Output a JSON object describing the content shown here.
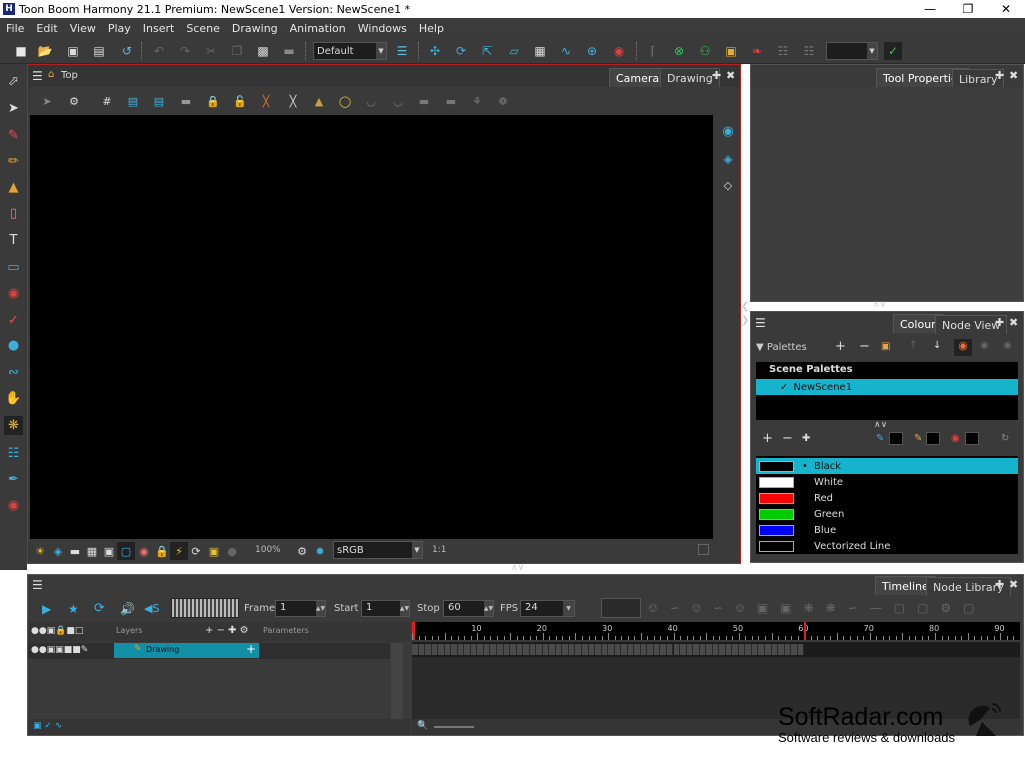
{
  "window": {
    "title": "Toon Boom Harmony 21.1 Premium: NewScene1 Version: NewScene1 *",
    "app_icon": "H"
  },
  "menu": [
    "File",
    "Edit",
    "View",
    "Play",
    "Insert",
    "Scene",
    "Drawing",
    "Animation",
    "Windows",
    "Help"
  ],
  "toolbar": {
    "workspace": "Default"
  },
  "camera_view": {
    "breadcrumb": "Top",
    "tabs": [
      "Camera",
      "Drawing"
    ],
    "zoom": "100%",
    "color_space": "sRGB",
    "ratio": "1:1"
  },
  "tool_properties": {
    "tabs": [
      "Tool Properties",
      "Library"
    ]
  },
  "colour": {
    "tabs": [
      "Colour",
      "Node View"
    ],
    "palettes_label": "Palettes",
    "scene_palettes_header": "Scene Palettes",
    "palette_name": "NewScene1",
    "colours": [
      {
        "name": "Black",
        "hex": "#000000"
      },
      {
        "name": "White",
        "hex": "#ffffff"
      },
      {
        "name": "Red",
        "hex": "#ff0000"
      },
      {
        "name": "Green",
        "hex": "#00cc00"
      },
      {
        "name": "Blue",
        "hex": "#0000ff"
      },
      {
        "name": "Vectorized Line",
        "hex": "#000000"
      }
    ],
    "selected_colour": "Black"
  },
  "timeline": {
    "tabs": [
      "Timeline",
      "Node Library"
    ],
    "frame_label": "Frame",
    "frame_value": "1",
    "start_label": "Start",
    "start_value": "1",
    "stop_label": "Stop",
    "stop_value": "60",
    "fps_label": "FPS",
    "fps_value": "24",
    "layers_header": "Layers",
    "parameters_header": "Parameters",
    "layer_name": "Drawing",
    "ruler_ticks": [
      "10",
      "20",
      "30",
      "40",
      "50",
      "60",
      "70",
      "80",
      "90"
    ],
    "scene_length_frames": 60,
    "visible_frames": 93
  },
  "watermark": {
    "brand": "SoftRadar.com",
    "tagline": "Software reviews & downloads"
  },
  "colors": {
    "accent": "#16b3cc",
    "panel_bg": "#3a3a3a",
    "active_border": "#b02020"
  }
}
